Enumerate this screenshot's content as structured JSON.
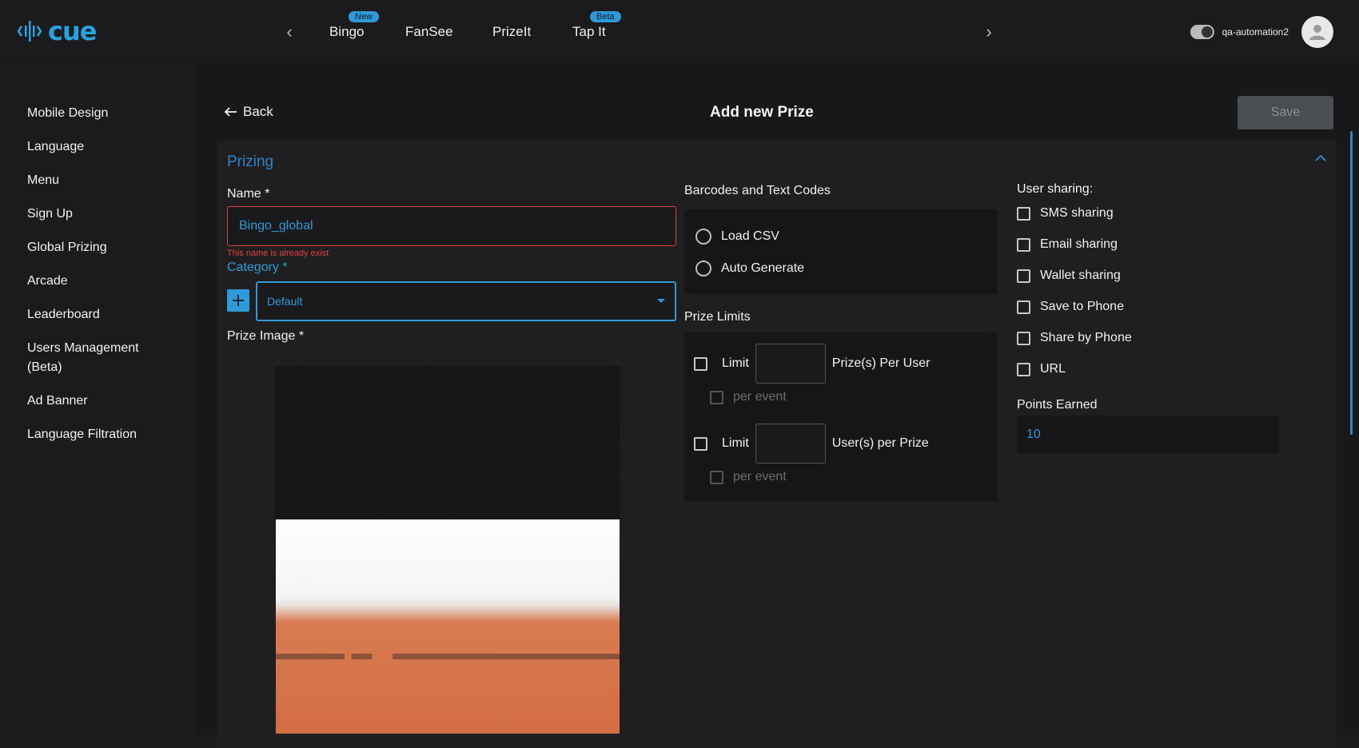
{
  "brand": {
    "name": "cue",
    "color": "#29a3e0"
  },
  "nav": {
    "prev_icon": "chevron-left-icon",
    "next_icon": "chevron-right-icon",
    "tabs": [
      {
        "label": "Bingo",
        "badge": "New"
      },
      {
        "label": "FanSee",
        "badge": ""
      },
      {
        "label": "PrizeIt",
        "badge": ""
      },
      {
        "label": "Tap It",
        "badge": "Beta"
      }
    ]
  },
  "user": {
    "name": "qa-automation2"
  },
  "sidebar": {
    "items": [
      {
        "label": "Mobile Design"
      },
      {
        "label": "Language"
      },
      {
        "label": "Menu"
      },
      {
        "label": "Sign Up"
      },
      {
        "label": "Global Prizing"
      },
      {
        "label": "Arcade"
      },
      {
        "label": "Leaderboard"
      },
      {
        "label": "Users Management (Beta)"
      },
      {
        "label": "Ad Banner"
      },
      {
        "label": "Language Filtration"
      }
    ]
  },
  "header": {
    "back_label": "Back",
    "title": "Add new Prize",
    "save_label": "Save"
  },
  "prizing": {
    "section_title": "Prizing",
    "name": {
      "label": "Name",
      "required": "*",
      "value": "Bingo_global",
      "error": "This name is already exist"
    },
    "category": {
      "label": "Category",
      "required": "*",
      "value": "Default"
    },
    "image": {
      "label": "Prize Image",
      "required": "*"
    },
    "codes": {
      "label": "Barcodes and Text Codes",
      "options": [
        "Load CSV",
        "Auto Generate"
      ]
    },
    "limits": {
      "label": "Prize Limits",
      "rows": [
        {
          "limit_label": "Limit",
          "suffix": "Prize(s) Per User",
          "per_event": "per event"
        },
        {
          "limit_label": "Limit",
          "suffix": "User(s) per Prize",
          "per_event": "per event"
        }
      ]
    },
    "sharing": {
      "label": "User sharing:",
      "options": [
        "SMS sharing",
        "Email sharing",
        "Wallet sharing",
        "Save to Phone",
        "Share by Phone",
        "URL"
      ]
    },
    "points": {
      "label": "Points Earned",
      "value": "10"
    }
  }
}
